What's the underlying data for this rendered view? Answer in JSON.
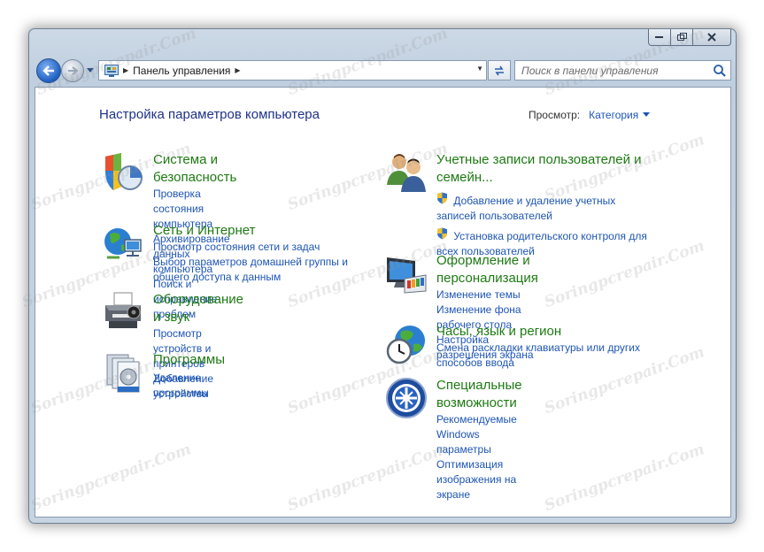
{
  "window": {
    "min_label": "▭",
    "max_label": "▢",
    "close_label": "✕"
  },
  "nav": {
    "breadcrumb": "Панель управления",
    "search_placeholder": "Поиск в панели управления"
  },
  "page": {
    "title": "Настройка параметров компьютера",
    "view_label": "Просмотр:",
    "view_value": "Категория"
  },
  "categories": [
    {
      "title": "Система и безопасность",
      "icon": "shield-chart-icon",
      "links": [
        "Проверка состояния компьютера",
        "Архивирование данных компьютера",
        "Поиск и исправление проблем"
      ]
    },
    {
      "title": "Сеть и Интернет",
      "icon": "globe-network-icon",
      "links": [
        "Просмотр состояния сети и задач",
        "Выбор параметров домашней группы и общего доступа к данным"
      ]
    },
    {
      "title": "Оборудование и звук",
      "icon": "printer-icon",
      "links": [
        "Просмотр устройств и принтеров",
        "Добавление устройства"
      ]
    },
    {
      "title": "Программы",
      "icon": "programs-icon",
      "links": [
        "Удаление программы"
      ]
    },
    {
      "title": "Учетные записи пользователей и семейн...",
      "icon": "users-icon",
      "links": [
        "Добавление и удаление учетных записей пользователей",
        "Установка родительского контроля для всех пользователей"
      ]
    },
    {
      "title": "Оформление и персонализация",
      "icon": "monitor-palette-icon",
      "links": [
        "Изменение темы",
        "Изменение фона рабочего стола",
        "Настройка разрешения экрана"
      ]
    },
    {
      "title": "Часы, язык и регион",
      "icon": "globe-clock-icon",
      "links": [
        "Смена раскладки клавиатуры или других способов ввода"
      ]
    },
    {
      "title": "Специальные возможности",
      "icon": "accessibility-icon",
      "links": [
        "Рекомендуемые Windows параметры",
        "Оптимизация изображения на экране"
      ]
    }
  ],
  "watermark": "Soringpcrepair.Com",
  "colors": {
    "category_title": "#1d7a12",
    "link": "#1d55b3",
    "page_title": "#1e3287"
  }
}
